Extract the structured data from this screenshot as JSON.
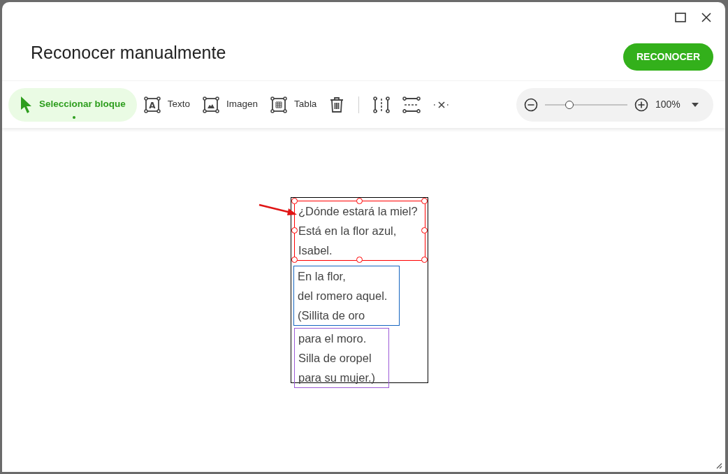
{
  "window": {
    "title": "Reconocer manualmente"
  },
  "primary_button": "RECONOCER",
  "tools": [
    {
      "kind": "select",
      "label": "Seleccionar bloque",
      "selected": true
    },
    {
      "kind": "text",
      "label": "Texto",
      "icon_text": "A",
      "selected": false
    },
    {
      "kind": "image",
      "label": "Imagen",
      "selected": false
    },
    {
      "kind": "table",
      "label": "Tabla",
      "selected": false
    },
    {
      "kind": "delete",
      "selected": false
    },
    {
      "kind": "separator"
    },
    {
      "kind": "split-vertical",
      "selected": false
    },
    {
      "kind": "split-horizontal",
      "selected": false
    },
    {
      "kind": "remove-split",
      "selected": false
    }
  ],
  "zoom": {
    "level": 0.3,
    "reading": "100%"
  },
  "blocks": [
    {
      "color": "#ff0000",
      "selected": true,
      "lines": [
        "¿Dónde estará la miel?",
        "Está en la flor azul,",
        "Isabel."
      ]
    },
    {
      "color": "#1565c0",
      "selected": false,
      "lines": [
        "En la flor,",
        "del romero aquel.",
        "(Sillita de oro"
      ]
    },
    {
      "color": "#9c5bd6",
      "selected": false,
      "lines": [
        "para el moro.",
        "Silla de oropel",
        "para su mujer.)"
      ]
    }
  ]
}
